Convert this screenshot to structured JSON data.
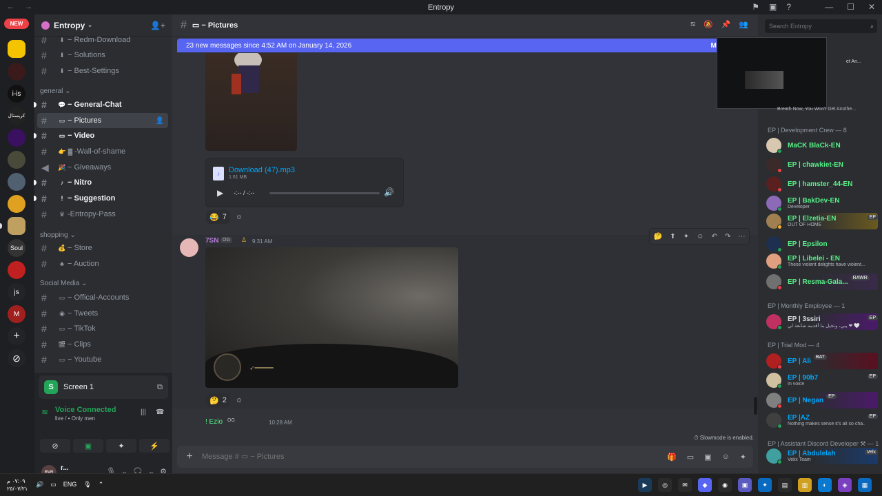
{
  "window": {
    "title": "Entropy",
    "nav_arrows": "← →",
    "title_icons": [
      "⚑",
      "▣",
      "?"
    ],
    "controls": [
      "—",
      "☐",
      "✕"
    ]
  },
  "servers": {
    "new_badge": "NEW",
    "labels": [
      "",
      "",
      "",
      "i-is",
      "كريستال",
      "",
      "",
      "",
      "",
      "",
      "",
      "Soul",
      "",
      "js",
      "M",
      "+",
      "⊘"
    ]
  },
  "channels": {
    "server_name": "Entropy",
    "server_chevron": "⌄",
    "items": [
      {
        "emoji": "⬇",
        "label": "− Redm-Download"
      },
      {
        "emoji": "⬇",
        "label": "− Solutions"
      },
      {
        "emoji": "⬇",
        "label": "− Best-Settings"
      },
      {
        "emoji": "💬",
        "label": "− General-Chat"
      },
      {
        "emoji": "▭",
        "label": "− Pictures"
      },
      {
        "emoji": "▭",
        "label": "− Video"
      },
      {
        "emoji": "👉 ▓",
        "label": "-Wall-of-shame"
      },
      {
        "emoji": "🎉",
        "label": "− Giveaways"
      },
      {
        "emoji": "♪",
        "label": "− Nitro"
      },
      {
        "emoji": "!",
        "label": "− Suggestion"
      },
      {
        "emoji": "♛",
        "label": "-Entropy-Pass"
      },
      {
        "emoji": "💰",
        "label": "− Store"
      },
      {
        "emoji": "♣",
        "label": "− Auction"
      },
      {
        "emoji": "▭",
        "label": "− Offical-Accounts"
      },
      {
        "emoji": "◉",
        "label": "− Tweets"
      },
      {
        "emoji": "▭",
        "label": "− TikTok"
      },
      {
        "emoji": "🎬",
        "label": "− Clips"
      },
      {
        "emoji": "▭",
        "label": "− Youtube"
      }
    ],
    "categories": {
      "general": "general",
      "shopping": "shopping",
      "social": "Social Media"
    }
  },
  "voice": {
    "screen_label": "Screen 1",
    "screen_icon": "S",
    "status": "Voice Connected",
    "substatus": "live / • Only men",
    "buttons": [
      "⊘",
      "▣",
      "✦",
      "⚡"
    ]
  },
  "user": {
    "name": "r...",
    "status": "emoji_61",
    "avatar_text": "RVR"
  },
  "main": {
    "channel_name": "▭ − Pictures",
    "banner_text": "23 new messages since 4:52 AM on January 14, 2026",
    "banner_action": "Mark As",
    "audio": {
      "filename": "Download (47).mp3",
      "size": "1.61 MB",
      "time": "-:-- / -:--",
      "progress": 0.0
    },
    "reaction1": {
      "emoji": "😂",
      "count": "7"
    },
    "message2": {
      "username": "7SN",
      "badge": "OG",
      "time": "9:31 AM"
    },
    "reaction2": {
      "emoji": "🤔",
      "count": "2"
    },
    "message3": {
      "username": "! Ezio",
      "badge": "OG",
      "time": "10:28 AM"
    },
    "slowmode": "Slowmode is enabled.",
    "composer_placeholder": "Message # ▭ − Pictures",
    "search_placeholder": "Search Entropy"
  },
  "members": {
    "groups": {
      "dev": "EP | Development Crew — 8",
      "monthly": "EP | Monthly Employee — 1",
      "trial": "EP | Trial Mod — 4",
      "assistant": "EP | Assistant Discord Developer ⚒ — 1"
    },
    "snippet_top": "Breath Now, You Won't Get Anothe...",
    "snippet_top2": "et An...",
    "list": [
      {
        "name": "MaCK BlaCk-EN",
        "sub": "",
        "tag": "",
        "color": "#57f287",
        "av": "#d8c8b0",
        "st": "#23a559"
      },
      {
        "name": "EP | chawkiet-EN",
        "sub": "",
        "tag": "",
        "color": "#57f287",
        "av": "#3a2a2a",
        "st": "#f23f43"
      },
      {
        "name": "EP | hamster_44-EN",
        "sub": "",
        "tag": "",
        "color": "#57f287",
        "av": "#5a2020",
        "st": "#f23f43"
      },
      {
        "name": "EP | BakDev-EN",
        "sub": "Developer",
        "tag": "",
        "color": "#57f287",
        "av": "#8c6ab8",
        "st": "#23a559"
      },
      {
        "name": "EP | Elzetia-EN",
        "sub": "OUT OF HOME",
        "tag": "EP",
        "color": "#57f287",
        "av": "#a08050",
        "st": "#f0b232"
      },
      {
        "name": "EP | Epsilon",
        "sub": "",
        "tag": "",
        "color": "#57f287",
        "av": "#1e3050",
        "st": "#23a559"
      },
      {
        "name": "EP | Libelei - EN",
        "sub": "These violent delights have violent...",
        "tag": "",
        "color": "#57f287",
        "av": "#e0a080",
        "st": "#23a559"
      },
      {
        "name": "EP | Resma-Gala...",
        "sub": "",
        "tag": "RAWR",
        "color": "#57f287",
        "av": "#707070",
        "st": "#f23f43"
      },
      {
        "name": "EP | 3ssiri",
        "sub": "يبي، وتجيل ما أقدمه شانعة لي ❤ 🤍",
        "tag": "EP",
        "color": "#dbdee1",
        "av": "#c03060",
        "st": "#23a559"
      },
      {
        "name": "EP | Ali",
        "sub": "",
        "tag": "BAT",
        "color": "#00a8fc",
        "av": "#b02020",
        "st": "#f23f43"
      },
      {
        "name": "EP | 90b7",
        "sub": "In voice",
        "tag": "EP",
        "color": "#00a8fc",
        "av": "#d0c0a0",
        "st": "#23a559"
      },
      {
        "name": "EP | Negan",
        "sub": "",
        "tag": "EP",
        "color": "#00a8fc",
        "av": "#808080",
        "st": "#f23f43"
      },
      {
        "name": "EP |AZ",
        "sub": "Nothing makes sense it's all so cha...",
        "tag": "EP",
        "color": "#00a8fc",
        "av": "#404040",
        "st": "#23a559"
      },
      {
        "name": "EP | Abdulelah",
        "sub": "Velix Team",
        "tag": "Velx",
        "color": "#00a8fc",
        "av": "#40a0a0",
        "st": "#23a559"
      }
    ]
  },
  "taskbar": {
    "time": "٠٧:٠٩ م",
    "date": "٢٥/٠٧/٢١",
    "lang": "ENG",
    "apps": [
      "▶",
      "◎",
      "✉",
      "◆",
      "◉",
      "▣",
      "✦",
      "▤",
      "▥",
      "◐",
      "◈",
      "▦"
    ]
  },
  "colors": {
    "accent": "#5865f2",
    "online": "#23a559",
    "dnd": "#f23f43"
  }
}
